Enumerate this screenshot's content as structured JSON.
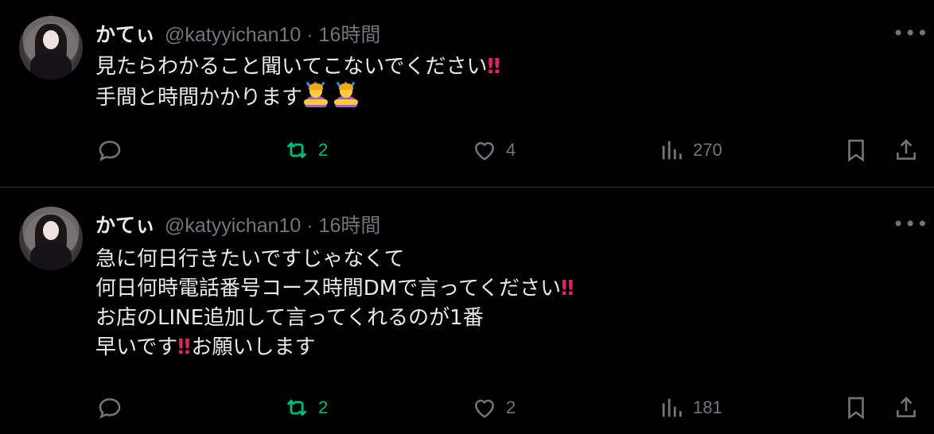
{
  "tweets": [
    {
      "name": "かてぃ",
      "handle_time": "@katyyichan10 · 16時間",
      "line1": "見たらわかること聞いてこないでください",
      "line1_mark": "‼",
      "line2": "手間と時間かかります",
      "emoji": "person-bowing-emoji",
      "stats": {
        "retweets": "2",
        "likes": "4",
        "views": "270"
      }
    },
    {
      "name": "かてぃ",
      "handle_time": "@katyyichan10 · 16時間",
      "line1": "急に何日行きたいですじゃなくて",
      "line2": "何日何時電話番号コース時間DMで言ってください",
      "line2_mark": "‼",
      "line3": "お店のLINE追加して言ってくれるのが1番",
      "line4_a": "早いです",
      "line4_mark": "‼",
      "line4_b": "お願いします",
      "stats": {
        "retweets": "2",
        "likes": "2",
        "views": "181"
      }
    }
  ],
  "more_label": "•••",
  "colors": {
    "background": "#000000",
    "text": "#e7e9ea",
    "muted": "#71767b",
    "retweet": "#00ba7c",
    "mark": "#e0245e",
    "divider": "#2f3336"
  }
}
